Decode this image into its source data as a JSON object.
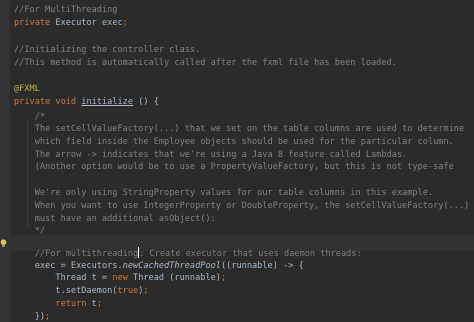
{
  "editor": {
    "lines": [
      {
        "text": "//For MultiThreading",
        "kind": "comment"
      },
      {
        "parts": [
          {
            "t": "private ",
            "s": "k"
          },
          {
            "t": "Executor exec",
            "s": "n"
          },
          {
            "t": ";",
            "s": "k"
          }
        ]
      },
      {
        "text": "",
        "kind": "blank"
      },
      {
        "text": "//Initializing the controller class.",
        "kind": "comment"
      },
      {
        "text": "//This method is automatically called after the fxml file has been loaded.",
        "kind": "comment"
      },
      {
        "text": "",
        "kind": "blank"
      },
      {
        "text": "@FXML",
        "kind": "annotation"
      },
      {
        "parts": [
          {
            "t": "private ",
            "s": "k"
          },
          {
            "t": "void ",
            "s": "k"
          },
          {
            "t": "initialize",
            "s": "u"
          },
          {
            "t": " () {",
            "s": "n"
          }
        ]
      },
      {
        "text": "    /*",
        "kind": "comment"
      },
      {
        "text": "    The setCellValueFactory(...) that we set on the table columns are used to determine",
        "kind": "comment"
      },
      {
        "text": "    which field inside the Employee objects should be used for the particular column.",
        "kind": "comment"
      },
      {
        "text": "    The arrow -> indicates that we're using a Java 8 feature called Lambdas.",
        "kind": "comment"
      },
      {
        "text": "    (Another option would be to use a PropertyValueFactory, but this is not type-safe",
        "kind": "comment"
      },
      {
        "text": "",
        "kind": "blank"
      },
      {
        "text": "    We're only using StringProperty values for our table columns in this example.",
        "kind": "comment"
      },
      {
        "text": "    When you want to use IntegerProperty or DoubleProperty, the setCellValueFactory(...)",
        "kind": "comment"
      },
      {
        "text": "    must have an additional asObject():",
        "kind": "comment"
      },
      {
        "text": "    */",
        "kind": "comment"
      },
      {
        "text": "",
        "kind": "blank"
      },
      {
        "before_caret": "    //For multithreading",
        "after_caret": ": Create executor that uses daemon threads:",
        "kind": "comment-caret"
      },
      {
        "parts": [
          {
            "t": "    exec = Executors.",
            "s": "n"
          },
          {
            "t": "newCachedThreadPool",
            "s": "i"
          },
          {
            "t": "((runnable) -> {",
            "s": "n"
          }
        ]
      },
      {
        "parts": [
          {
            "t": "        Thread t = ",
            "s": "n"
          },
          {
            "t": "new ",
            "s": "k"
          },
          {
            "t": "Thread (runnable)",
            "s": "n"
          },
          {
            "t": ";",
            "s": "k"
          }
        ]
      },
      {
        "parts": [
          {
            "t": "        t.setDaemon(",
            "s": "n"
          },
          {
            "t": "true",
            "s": "k"
          },
          {
            "t": ")",
            "s": "n"
          },
          {
            "t": ";",
            "s": "k"
          }
        ]
      },
      {
        "parts": [
          {
            "t": "        ",
            "s": "n"
          },
          {
            "t": "return ",
            "s": "k"
          },
          {
            "t": "t",
            "s": "n"
          },
          {
            "t": ";",
            "s": "k"
          }
        ]
      },
      {
        "parts": [
          {
            "t": "    })",
            "s": "n"
          },
          {
            "t": ";",
            "s": "k"
          }
        ]
      }
    ]
  },
  "colors": {
    "background": "#2b2b2b",
    "text": "#a9b7c6",
    "keyword": "#cc7832",
    "comment": "#808080",
    "annotation": "#bbb529",
    "current_line": "#323232"
  },
  "icons": {
    "intention": "lightbulb-icon"
  }
}
